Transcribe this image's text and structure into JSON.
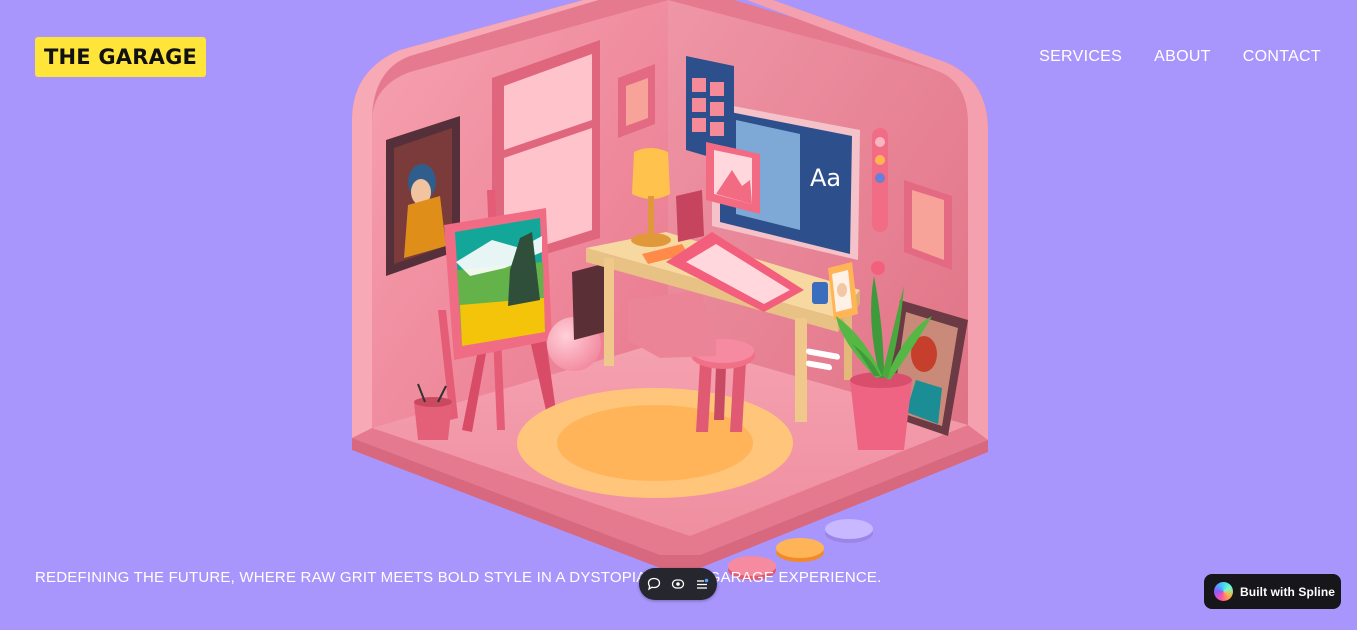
{
  "logo": {
    "text": "THE GARAGE"
  },
  "nav": {
    "items": [
      "SERVICES",
      "ABOUT",
      "CONTACT"
    ]
  },
  "scene": {
    "monitor_text": "Aa"
  },
  "tagline": "REDEFINING THE FUTURE, WHERE RAW GRIT MEETS BOLD STYLE IN A DYSTOPIAN-TECH GARAGE EXPERIENCE.",
  "toolbar": {
    "icons": [
      "comment-icon",
      "eye-icon",
      "list-icon"
    ]
  },
  "badge": {
    "text": "Built with Spline"
  },
  "colors": {
    "background": "#a996fd",
    "logo_bg": "#ffe43a",
    "room_pink": "#f08a9c",
    "toolbar_bg": "#25262e"
  }
}
